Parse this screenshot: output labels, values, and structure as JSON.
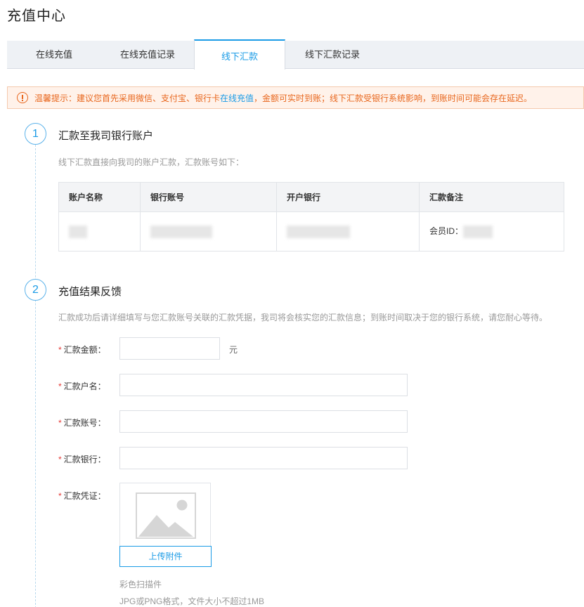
{
  "page_title": "充值中心",
  "tabs": [
    {
      "label": "在线充值"
    },
    {
      "label": "在线充值记录"
    },
    {
      "label": "线下汇款",
      "active": true
    },
    {
      "label": "线下汇款记录"
    }
  ],
  "notice": {
    "prefix": "温馨提示：建议您首先采用微信、支付宝、银行卡",
    "link": "在线充值",
    "suffix": "，金额可实时到账；线下汇款受银行系统影响，到账时间可能会存在延迟。"
  },
  "step1": {
    "number": "1",
    "title": "汇款至我司银行账户",
    "desc": "线下汇款直接向我司的账户汇款，汇款账号如下：",
    "table": {
      "headers": [
        "账户名称",
        "银行账号",
        "开户银行",
        "汇款备注"
      ],
      "member_id_label": "会员ID："
    }
  },
  "step2": {
    "number": "2",
    "title": "充值结果反馈",
    "desc": "汇款成功后请详细填写与您汇款账号关联的汇款凭据，我司将会核实您的汇款信息；到账时间取决于您的银行系统，请您耐心等待。",
    "form": {
      "amount_label": "汇款金额：",
      "amount_unit": "元",
      "name_label": "汇款户名：",
      "account_label": "汇款账号：",
      "bank_label": "汇款银行：",
      "voucher_label": "汇款凭证："
    },
    "upload": {
      "button_label": "上传附件",
      "hint1": "彩色扫描件",
      "hint2": "JPG或PNG格式，文件大小不超过1MB"
    }
  },
  "colors": {
    "accent": "#1a9be6",
    "warning": "#e8671e",
    "required": "#e53935"
  }
}
